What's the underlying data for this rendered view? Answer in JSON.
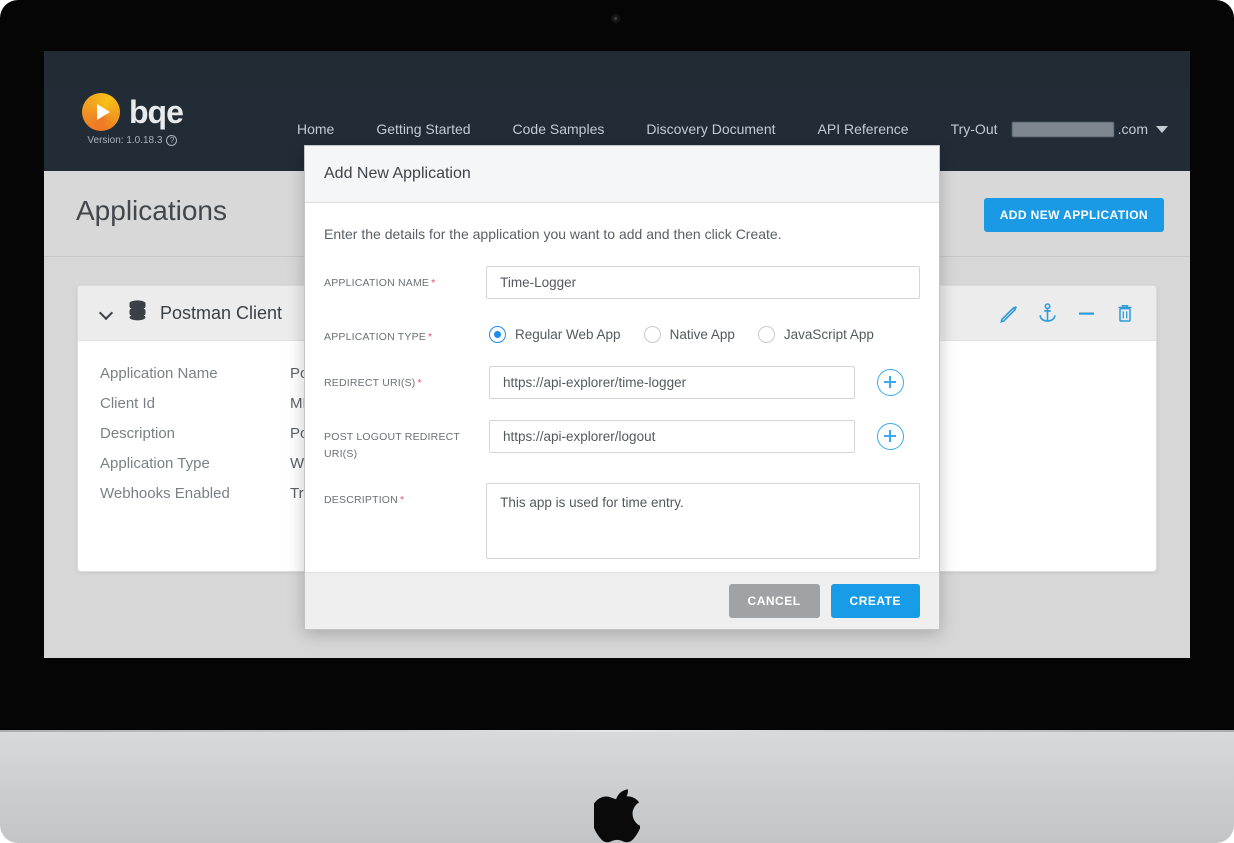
{
  "device": {
    "type": "imac-monitor",
    "camera": "camera-dot",
    "chin_logo": "apple-logo"
  },
  "navbar": {
    "brand_name": "bqe",
    "brand_logo": "bqe-play-logo",
    "version_label": "Version: 1.0.18.3",
    "version_help_icon": "question-mark-icon",
    "links": [
      {
        "label": "Home"
      },
      {
        "label": "Getting Started"
      },
      {
        "label": "Code Samples"
      },
      {
        "label": "Discovery Document"
      },
      {
        "label": "API Reference"
      },
      {
        "label": "Try-Out"
      }
    ],
    "account": {
      "email_redacted": true,
      "domain_suffix": ".com",
      "chevron_icon": "chevron-down-icon"
    }
  },
  "page": {
    "title": "Applications",
    "add_button": "ADD NEW APPLICATION"
  },
  "card": {
    "expand_icon": "chevron-down-icon",
    "type_icon": "database-icon",
    "title": "Postman Client",
    "actions": [
      {
        "name": "edit",
        "icon": "pencil-icon"
      },
      {
        "name": "anchor",
        "icon": "anchor-icon"
      },
      {
        "name": "remove",
        "icon": "minus-icon"
      },
      {
        "name": "delete",
        "icon": "trash-icon"
      }
    ],
    "details": [
      {
        "label": "Application Name",
        "value": "Pos"
      },
      {
        "label": "Client Id",
        "value": "ML"
      },
      {
        "label": "Description",
        "value": "Pos"
      },
      {
        "label": "Application Type",
        "value": "Wel"
      },
      {
        "label": "Webhooks Enabled",
        "value": "True"
      }
    ]
  },
  "modal": {
    "title": "Add New Application",
    "intro": "Enter the details for the application you want to add and then click Create.",
    "fields": {
      "app_name": {
        "label": "APPLICATION NAME",
        "required": true,
        "value": "Time-Logger",
        "placeholder": ""
      },
      "app_type": {
        "label": "APPLICATION TYPE",
        "required": true,
        "options": [
          {
            "label": "Regular Web App",
            "selected": true
          },
          {
            "label": "Native App",
            "selected": false
          },
          {
            "label": "JavaScript App",
            "selected": false
          }
        ]
      },
      "redirect_uris": {
        "label": "REDIRECT URI(S)",
        "required": true,
        "value": "https://api-explorer/time-logger",
        "placeholder": "",
        "add_icon": "plus-circle-icon"
      },
      "post_logout_uris": {
        "label": "POST LOGOUT REDIRECT URI(S)",
        "required": false,
        "value": "https://api-explorer/logout",
        "placeholder": "",
        "add_icon": "plus-circle-icon"
      },
      "description": {
        "label": "DESCRIPTION",
        "required": true,
        "value": "This app is used for time entry.",
        "placeholder": ""
      }
    },
    "footer": {
      "cancel_label": "CANCEL",
      "create_label": "CREATE"
    }
  },
  "colors": {
    "nav_background": "#222c37",
    "page_background": "#d8d8d8",
    "primary_blue": "#189ce8",
    "icon_blue": "#2d9cdb",
    "required_red": "#ef4e6b",
    "cancel_gray": "#a0a3a6",
    "logo_orange": "#ef7b26"
  }
}
